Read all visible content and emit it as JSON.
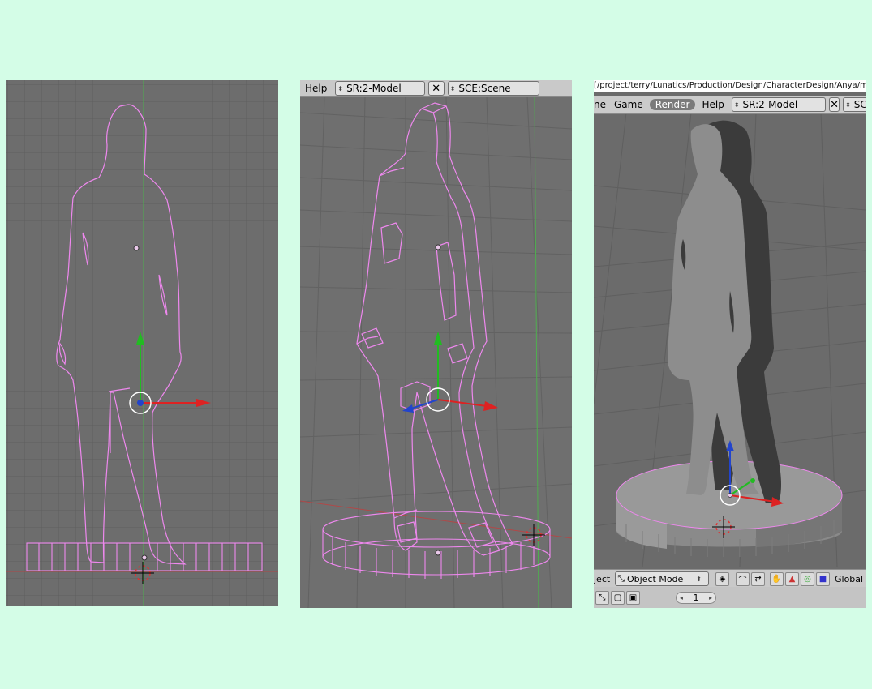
{
  "panel2_header": {
    "help": "Help",
    "screen": "SR:2-Model",
    "close": "✕",
    "scene": "SCE:Scene"
  },
  "panel3_path": "[/project/terry/Lunatics/Production/Design/CharacterDesign/Anya/mo",
  "panel3_header": {
    "menu_partial": "ne",
    "game": "Game",
    "render": "Render",
    "help": "Help",
    "screen": "SR:2-Model",
    "close": "✕",
    "scene_partial": "SCE:"
  },
  "panel3_bottom": {
    "object_partial": "ject",
    "mode": "Object Mode",
    "orientation": "Global",
    "frame": "1"
  },
  "colors": {
    "wire": "#ee88ee",
    "axis_x": "#dd2222",
    "axis_y": "#22bb22",
    "axis_z": "#2244cc",
    "background": "#d4fde7"
  }
}
